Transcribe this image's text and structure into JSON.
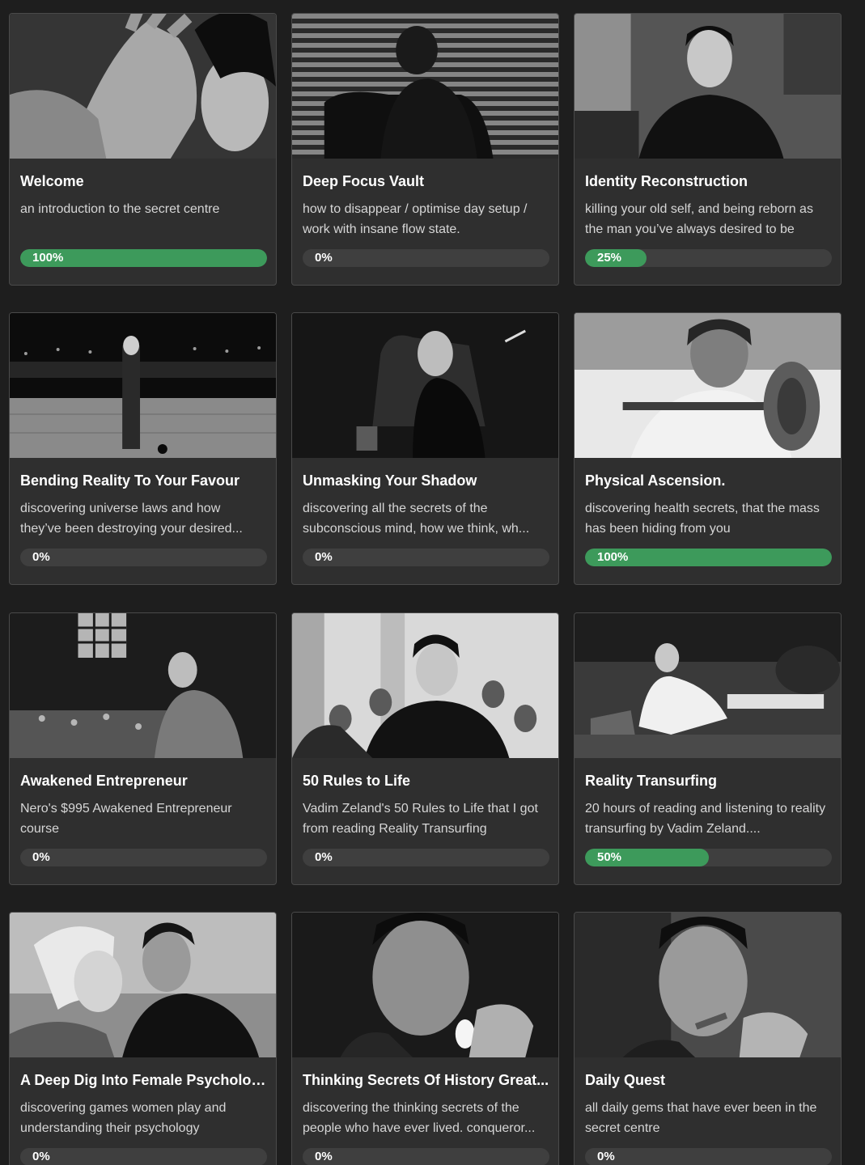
{
  "colors": {
    "background": "#1e1e1e",
    "card": "#2f2f2f",
    "progress_track": "#3f3f3f",
    "progress_fill": "#3d9a5b"
  },
  "courses": [
    {
      "title": "Welcome",
      "description": "an introduction to the secret centre",
      "progress_label": "100%",
      "progress": 1.0
    },
    {
      "title": "Deep Focus Vault",
      "description": "how to disappear / optimise day setup / work with insane flow state.",
      "progress_label": "0%",
      "progress": 0.0
    },
    {
      "title": "Identity Reconstruction",
      "description": "killing your old self, and being reborn as the man you’ve always desired to be",
      "progress_label": "25%",
      "progress": 0.25
    },
    {
      "title": "Bending Reality To Your Favour",
      "description": "discovering universe laws and how they’ve been destroying your desired...",
      "progress_label": "0%",
      "progress": 0.0
    },
    {
      "title": "Unmasking Your Shadow",
      "description": "discovering all the secrets of the subconscious mind, how we think, wh...",
      "progress_label": "0%",
      "progress": 0.0
    },
    {
      "title": "Physical Ascension.",
      "description": "discovering health secrets, that the mass has been hiding from you",
      "progress_label": "100%",
      "progress": 1.0
    },
    {
      "title": "Awakened Entrepreneur",
      "description": "Nero's $995 Awakened Entrepreneur course",
      "progress_label": "0%",
      "progress": 0.0
    },
    {
      "title": "50 Rules to Life",
      "description": "Vadim Zeland's 50 Rules to Life that I got from reading Reality Transurfing",
      "progress_label": "0%",
      "progress": 0.0
    },
    {
      "title": "Reality Transurfing",
      "description": "20 hours of reading and listening to reality transurfing by Vadim Zeland....",
      "progress_label": "50%",
      "progress": 0.5
    },
    {
      "title": "A Deep Dig Into Female Psychology",
      "description": "discovering games women play and understanding their psychology",
      "progress_label": "0%",
      "progress": 0.0
    },
    {
      "title": "Thinking Secrets Of History Great...",
      "description": "discovering the thinking secrets of the people who have ever lived. conqueror...",
      "progress_label": "0%",
      "progress": 0.0
    },
    {
      "title": "Daily Quest",
      "description": "all daily gems that have ever been in the secret centre",
      "progress_label": "0%",
      "progress": 0.0
    }
  ]
}
